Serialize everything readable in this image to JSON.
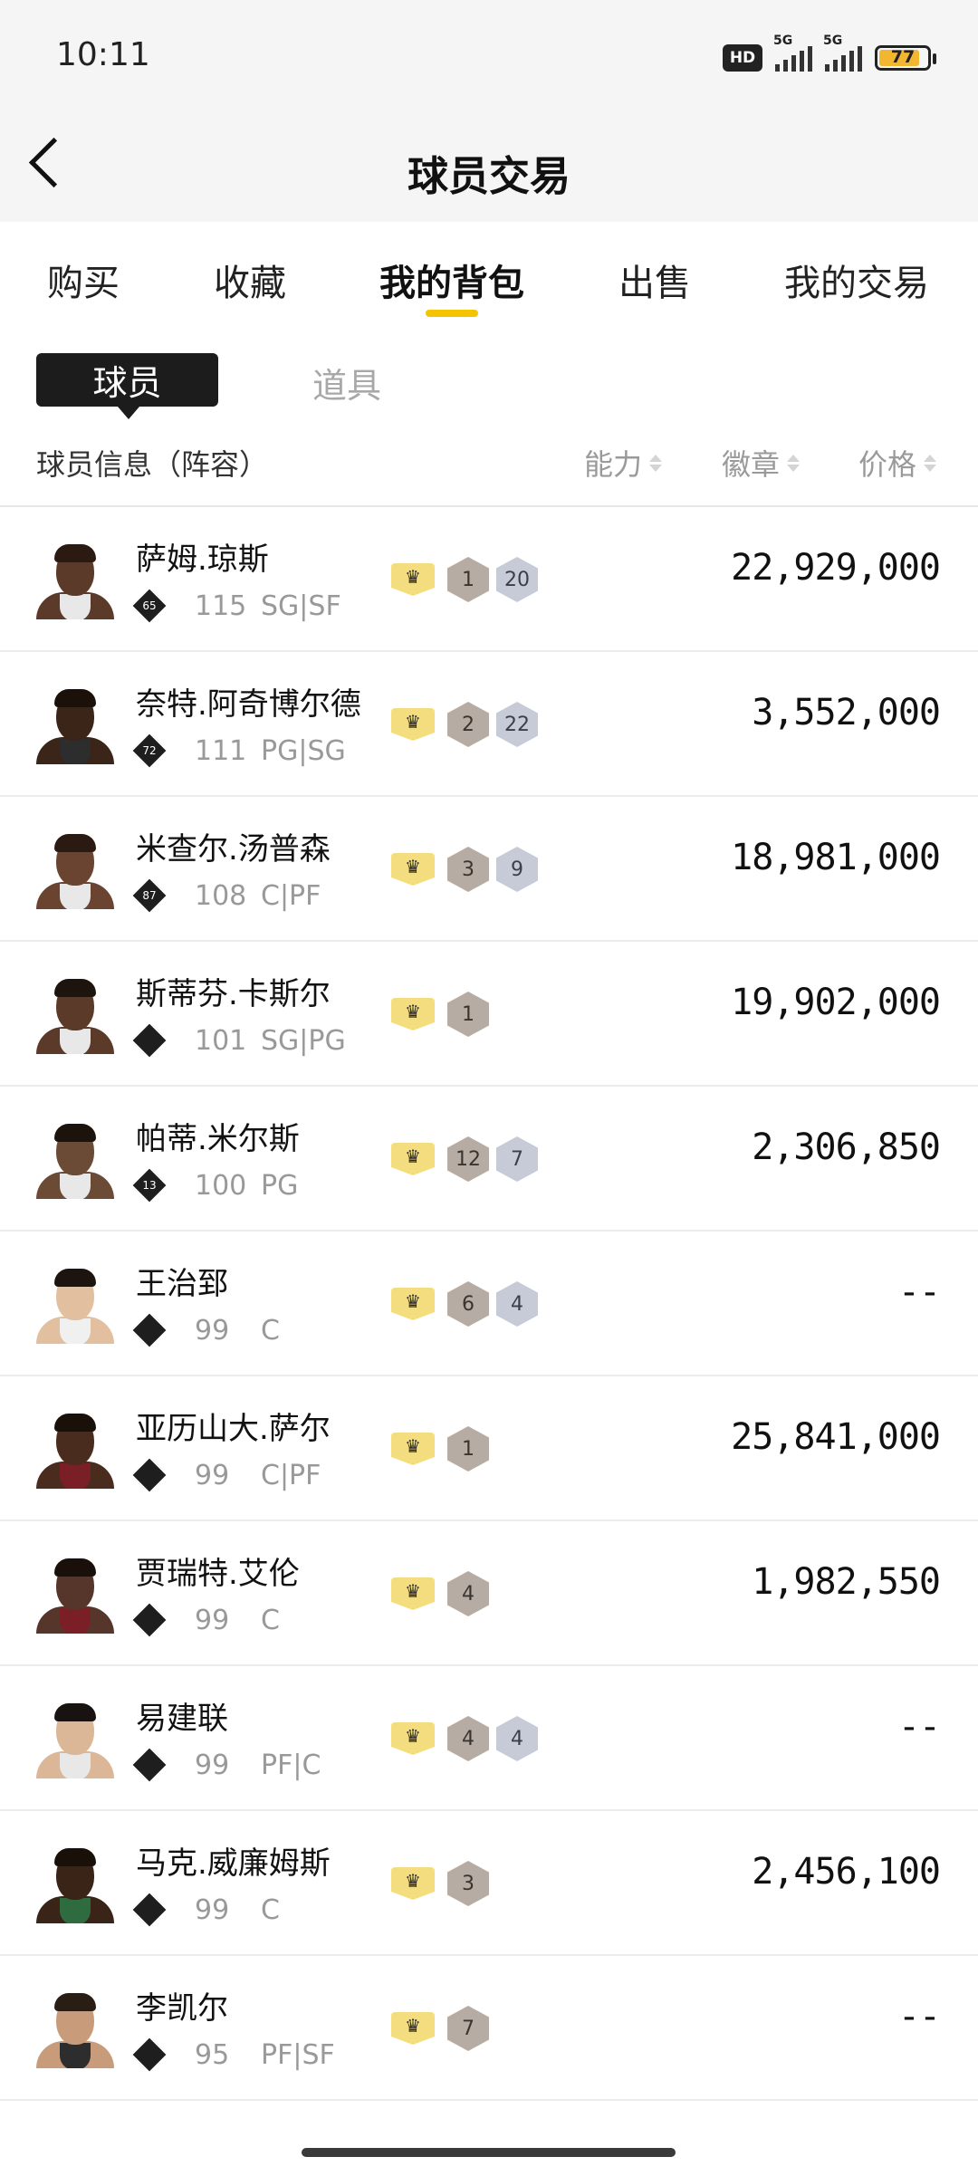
{
  "status_bar": {
    "time": "10:11",
    "hd": "HD",
    "sim1": "5G",
    "sim2": "5G",
    "battery": "77"
  },
  "header": {
    "title": "球员交易"
  },
  "tabs": [
    {
      "label": "购买"
    },
    {
      "label": "收藏"
    },
    {
      "label": "我的背包"
    },
    {
      "label": "出售"
    },
    {
      "label": "我的交易"
    }
  ],
  "active_tab": "我的背包",
  "segments": {
    "player": "球员",
    "items": "道具"
  },
  "columns": {
    "info": "球员信息（阵容）",
    "ability": "能力",
    "badge": "徽章",
    "price": "价格"
  },
  "players": [
    {
      "name": "萨姆.琼斯",
      "rank": "65",
      "ovr": "115",
      "pos": "SG|SF",
      "badge1": "1",
      "badge2": "20",
      "price": "22,929,000",
      "skin": "#5b3a2a",
      "hair": "#2a1a12",
      "jersey": "#e8e8e8"
    },
    {
      "name": "奈特.阿奇博尔德",
      "rank": "72",
      "ovr": "111",
      "pos": "PG|SG",
      "badge1": "2",
      "badge2": "22",
      "price": "3,552,000",
      "skin": "#3b2418",
      "hair": "#1b100a",
      "jersey": "#2d2d2d"
    },
    {
      "name": "米查尔.汤普森",
      "rank": "87",
      "ovr": "108",
      "pos": "C|PF",
      "badge1": "3",
      "badge2": "9",
      "price": "18,981,000",
      "skin": "#6a4331",
      "hair": "#2a1a12",
      "jersey": "#e8e8e8"
    },
    {
      "name": "斯蒂芬.卡斯尔",
      "rank": "",
      "ovr": "101",
      "pos": "SG|PG",
      "badge1": "1",
      "badge2": "",
      "price": "19,902,000",
      "skin": "#5c3a29",
      "hair": "#1d140e",
      "jersey": "#e8e8e8"
    },
    {
      "name": "帕蒂.米尔斯",
      "rank": "13",
      "ovr": "100",
      "pos": "PG",
      "badge1": "12",
      "badge2": "7",
      "price": "2,306,850",
      "skin": "#6b4a36",
      "hair": "#1c130d",
      "jersey": "#e8e8e8"
    },
    {
      "name": "王治郅",
      "rank": "",
      "ovr": "99",
      "pos": "C",
      "badge1": "6",
      "badge2": "4",
      "price": "--",
      "skin": "#e2bf9e",
      "hair": "#1c140f",
      "jersey": "#f0f0f0"
    },
    {
      "name": "亚历山大.萨尔",
      "rank": "",
      "ovr": "99",
      "pos": "C|PF",
      "badge1": "1",
      "badge2": "",
      "price": "25,841,000",
      "skin": "#4a2c1e",
      "hair": "#1a100a",
      "jersey": "#7a1f25"
    },
    {
      "name": "贾瑞特.艾伦",
      "rank": "",
      "ovr": "99",
      "pos": "C",
      "badge1": "4",
      "badge2": "",
      "price": "1,982,550",
      "skin": "#56352a",
      "hair": "#1a100b",
      "jersey": "#7a1f25"
    },
    {
      "name": "易建联",
      "rank": "",
      "ovr": "99",
      "pos": "PF|C",
      "badge1": "4",
      "badge2": "4",
      "price": "--",
      "skin": "#dcb797",
      "hair": "#181210",
      "jersey": "#e8e8e8"
    },
    {
      "name": "马克.威廉姆斯",
      "rank": "",
      "ovr": "99",
      "pos": "C",
      "badge1": "3",
      "badge2": "",
      "price": "2,456,100",
      "skin": "#3a2317",
      "hair": "#1a100a",
      "jersey": "#2e6b3e"
    },
    {
      "name": "李凯尔",
      "rank": "",
      "ovr": "95",
      "pos": "PF|SF",
      "badge1": "7",
      "badge2": "",
      "price": "--",
      "skin": "#c89b7b",
      "hair": "#2a1d14",
      "jersey": "#2d2d2d"
    }
  ]
}
